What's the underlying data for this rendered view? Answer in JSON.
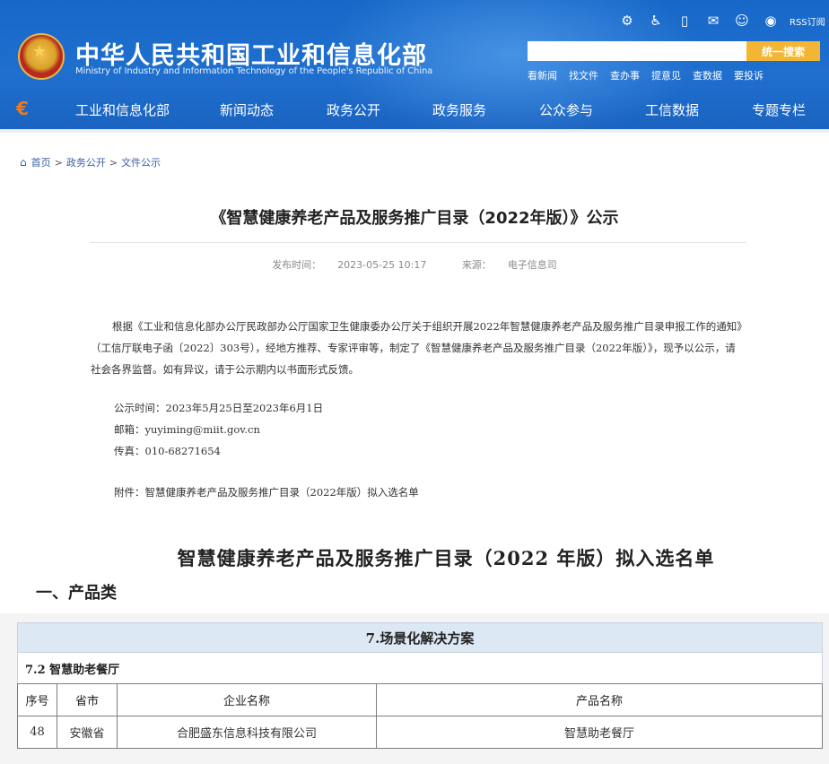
{
  "header": {
    "title_cn": "中华人民共和国工业和信息化部",
    "title_en": "Ministry of Industry and Information Technology of the People's Republic of China",
    "top_icons": [
      "robot-icon",
      "accessibility-icon",
      "mobile-icon",
      "mail-icon",
      "wechat-icon",
      "weibo-icon"
    ],
    "rss_label": "RSS订阅",
    "search": {
      "placeholder": "",
      "button_label": "统一搜索"
    },
    "quick_links": [
      "看新闻",
      "找文件",
      "查办事",
      "提意见",
      "查数据",
      "要投诉"
    ],
    "nav": [
      "工业和信息化部",
      "新闻动态",
      "政务公开",
      "政务服务",
      "公众参与",
      "工信数据",
      "专题专栏"
    ],
    "colors": {
      "header_bg": "#1a66c6",
      "search_button": "#f2b534"
    }
  },
  "breadcrumb": [
    "首页",
    "政务公开",
    "文件公示"
  ],
  "article": {
    "title": "《智慧健康养老产品及服务推广目录（2022年版）》公示",
    "publish_label": "发布时间：",
    "publish_time": "2023-05-25 10:17",
    "source_label": "来源：",
    "source": "电子信息司",
    "body": "根据《工业和信息化部办公厅民政部办公厅国家卫生健康委办公厅关于组织开展2022年智慧健康养老产品及服务推广目录申报工作的通知》（工信厅联电子函〔2022〕303号），经地方推荐、专家评审等，制定了《智慧健康养老产品及服务推广目录（2022年版）》，现予以公示，请社会各界监督。如有异议，请于公示期内以书面形式反馈。",
    "notice_period": "公示时间：2023年5月25日至2023年6月1日",
    "email": "邮箱：yuyiming@miit.gov.cn",
    "fax": "传真：010-68271654",
    "attachment": "附件：智慧健康养老产品及服务推广目录（2022年版）拟入选名单"
  },
  "list": {
    "title": "智慧健康养老产品及服务推广目录（2022 年版）拟入选名单",
    "section": "一、产品类",
    "scene_header": "7.场景化解决方案",
    "sub_header": "7.2 智慧助老餐厅",
    "columns": [
      "序号",
      "省市",
      "企业名称",
      "产品名称"
    ],
    "rows": [
      {
        "no": "48",
        "province": "安徽省",
        "company": "合肥盛东信息科技有限公司",
        "product": "智慧助老餐厅"
      }
    ]
  }
}
